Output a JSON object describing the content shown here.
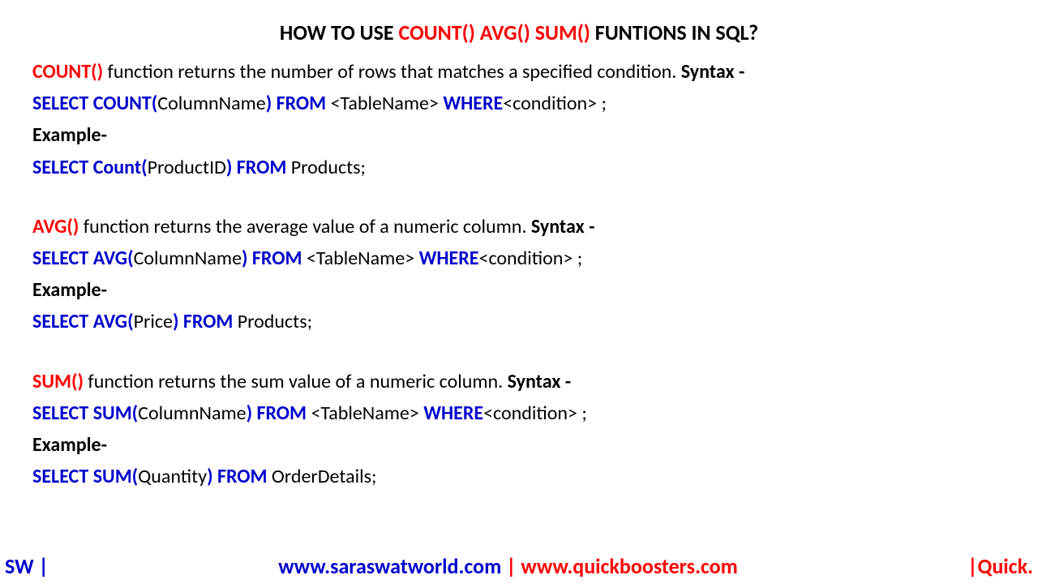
{
  "title": {
    "prefix": "HOW TO USE ",
    "highlight": "COUNT() AVG() SUM()",
    "suffix": " FUNTIONS IN SQL?"
  },
  "sections": [
    {
      "func": "COUNT()",
      "desc": " function returns the number of rows that matches a specified condition. ",
      "syntaxLabel": "Syntax -",
      "syntax": {
        "select": "SELECT  ",
        "open": "COUNT(",
        "col": "ColumnName",
        "close": ")  FROM ",
        "table": "<TableName> ",
        "where": "WHERE",
        "cond": "<condition>  ;"
      },
      "exampleLabel": "Example-",
      "example": {
        "select": "SELECT  ",
        "open": "Count(",
        "col": "ProductID",
        "close": ") FROM ",
        "tail": "Products;"
      }
    },
    {
      "func": "AVG()",
      "desc": " function returns the average value of a numeric column. ",
      "syntaxLabel": "Syntax -",
      "syntax": {
        "select": "SELECT  ",
        "open": "AVG(",
        "col": "ColumnName",
        "close": ")  FROM ",
        "table": "<TableName> ",
        "where": "WHERE",
        "cond": "<condition>  ;"
      },
      "exampleLabel": "Example-",
      "example": {
        "select": "SELECT  ",
        "open": "AVG(",
        "col": "Price",
        "close": ") FROM ",
        "tail": "Products;"
      }
    },
    {
      "func": "SUM()",
      "desc": " function returns the sum value of a numeric column. ",
      "syntaxLabel": "Syntax -",
      "syntax": {
        "select": "SELECT  ",
        "open": "SUM(",
        "col": "ColumnName",
        "close": ")  FROM ",
        "table": "<TableName> ",
        "where": "WHERE",
        "cond": "<condition>  ;"
      },
      "exampleLabel": "Example-",
      "example": {
        "select": "SELECT  ",
        "open": "SUM(",
        "col": "Quantity",
        "close": ") FROM ",
        "tail": "OrderDetails;"
      }
    }
  ],
  "footer": {
    "left": "SW |",
    "url1": "www.saraswatworld.com",
    "sep": " | ",
    "url2": "www.quickboosters.com",
    "right": "|Quick."
  }
}
